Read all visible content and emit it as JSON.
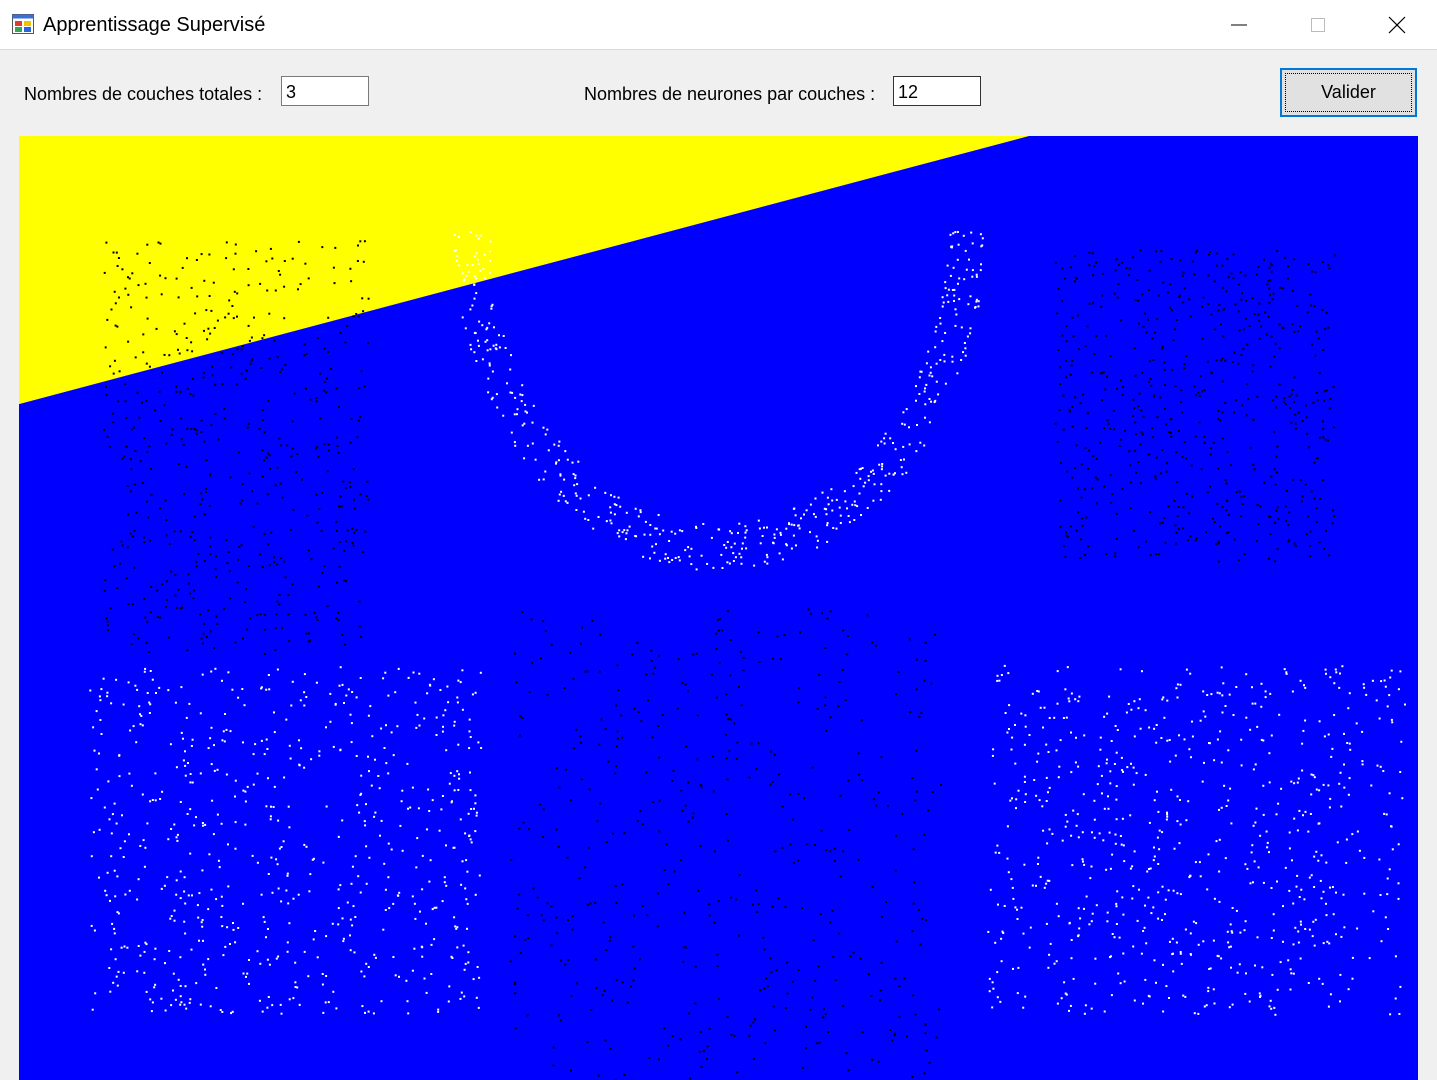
{
  "window": {
    "title": "Apprentissage Supervisé",
    "icon": "windows-form-icon",
    "controls": [
      "minimize-icon",
      "maximize-icon",
      "close-icon"
    ]
  },
  "form": {
    "layers_label": "Nombres de couches totales :",
    "layers_value": "3",
    "neurons_label": "Nombres de neurones par couches :",
    "neurons_value": "12",
    "validate_label": "Valider"
  },
  "colors": {
    "region_class_a": "#ffff00",
    "region_class_b": "#0000ff",
    "points_class_a": "#000000",
    "points_class_b": "#ffffff",
    "accent": "#0078d7"
  },
  "chart_data": {
    "type": "scatter",
    "title": "",
    "xlabel": "",
    "ylabel": "",
    "grid": false,
    "legend": "none",
    "decision_boundary": {
      "type": "line",
      "upper_left_class": "class_a",
      "lower_right_class": "class_b",
      "endpoint_left": [
        0.0,
        0.716
      ],
      "endpoint_right": [
        0.722,
        1.0
      ]
    },
    "series": [
      {
        "class": "class_a",
        "color": "#000000",
        "clusters": [
          {
            "shape": "blob",
            "x_range": [
              0.06,
              0.25
            ],
            "y_range": [
              0.45,
              0.89
            ],
            "count": 520
          },
          {
            "shape": "blob",
            "x_range": [
              0.74,
              0.94
            ],
            "y_range": [
              0.55,
              0.88
            ],
            "count": 560
          },
          {
            "shape": "blob",
            "x_range": [
              0.35,
              0.66
            ],
            "y_range": [
              0.0,
              0.5
            ],
            "count": 450
          }
        ]
      },
      {
        "class": "class_b",
        "color": "#ffffff",
        "clusters": [
          {
            "shape": "arc",
            "x_range": [
              0.31,
              0.69
            ],
            "y_range": [
              0.54,
              0.9
            ],
            "count": 480
          },
          {
            "shape": "blob",
            "x_range": [
              0.05,
              0.33
            ],
            "y_range": [
              0.07,
              0.44
            ],
            "count": 650
          },
          {
            "shape": "blob",
            "x_range": [
              0.69,
              0.99
            ],
            "y_range": [
              0.07,
              0.44
            ],
            "count": 700
          }
        ]
      }
    ]
  }
}
